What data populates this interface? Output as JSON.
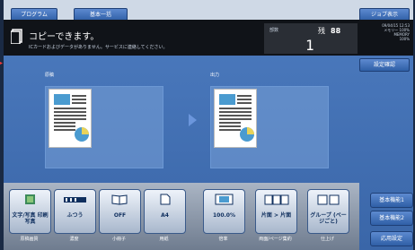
{
  "top": {
    "program_label": "プログラム",
    "basic_label": "基本一括",
    "job_display_label": "ジョブ表示"
  },
  "banner": {
    "status_title": "コピーできます。",
    "status_sub": "ICカードおよびデータがありません。サービスに連絡してください。",
    "counter_label": "部数",
    "count": "1",
    "sep_label": "残",
    "counter_right": "88",
    "info_lines": [
      "09/04/15 12:53",
      "メモリー 100%",
      "MEMORY",
      "100%"
    ]
  },
  "setting_confirm_label": "設定確認",
  "preview": {
    "original_label": "原稿",
    "output_label": "出力"
  },
  "functions": [
    {
      "value": "文字/写真 印刷写真",
      "under": "原稿画質",
      "icon": "color-mode-icon"
    },
    {
      "value": "ふつう",
      "under": "濃度",
      "icon": "density-icon"
    },
    {
      "value": "OFF",
      "under": "小冊子",
      "icon": "booklet-icon"
    },
    {
      "value": "A4",
      "under": "用紙",
      "icon": "paper-icon"
    },
    {
      "value": "100.0%",
      "under": "倍率",
      "icon": "zoom-icon"
    },
    {
      "value": "片面 > 片面",
      "under": "両面/ページ集約",
      "icon": "duplex-icon"
    },
    {
      "value": "グループ (ページごと)",
      "under": "仕上げ",
      "icon": "finishing-icon"
    }
  ],
  "right_buttons": [
    "基本機能1",
    "基本機能2",
    "応用設定"
  ],
  "colors": {
    "screen_bg": "#4d7cc0",
    "banner_bg": "#101318",
    "accent_blue": "#2f5fa6"
  }
}
